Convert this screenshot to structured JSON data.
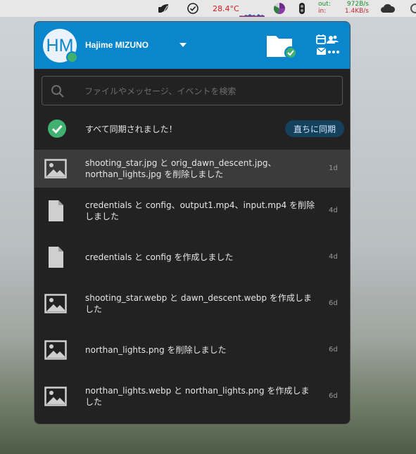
{
  "menubar": {
    "temperature": "28.4°C",
    "net_out_label": "out:",
    "net_out_value": "972B/s",
    "net_in_label": "in:",
    "net_in_value": "1.4KB/s"
  },
  "header": {
    "avatar_initials": "HM",
    "username": "Hajime MIZUNO"
  },
  "search": {
    "placeholder": "ファイルやメッセージ、イベントを検索"
  },
  "status": {
    "text": "すべて同期されました！",
    "sync_button": "直ちに同期"
  },
  "activities": [
    {
      "icon": "image-icon",
      "line1": "shooting_star.jpg と orig_dawn_descent.jpg、",
      "line2": "northan_lights.jpg を削除しました",
      "time": "1d"
    },
    {
      "icon": "file-icon",
      "line1": "credentials と config、output1.mp4、input.mp4 を削除",
      "line2": "しました",
      "time": "4d"
    },
    {
      "icon": "file-icon",
      "line1": "credentials と config を作成しました",
      "line2": "",
      "time": "4d"
    },
    {
      "icon": "image-icon",
      "line1": "shooting_star.webp と dawn_descent.webp を作成しま",
      "line2": "した",
      "time": "6d"
    },
    {
      "icon": "image-icon",
      "line1": "northan_lights.png を削除しました",
      "line2": "",
      "time": "6d"
    },
    {
      "icon": "image-icon",
      "line1": "northan_lights.webp と northan_lights.png を作成しま",
      "line2": "した",
      "time": "6d"
    }
  ],
  "colors": {
    "header_bg": "#0a86cc",
    "panel_bg": "#222222",
    "status_green": "#3fb06f",
    "sync_button_bg": "#16415d"
  }
}
